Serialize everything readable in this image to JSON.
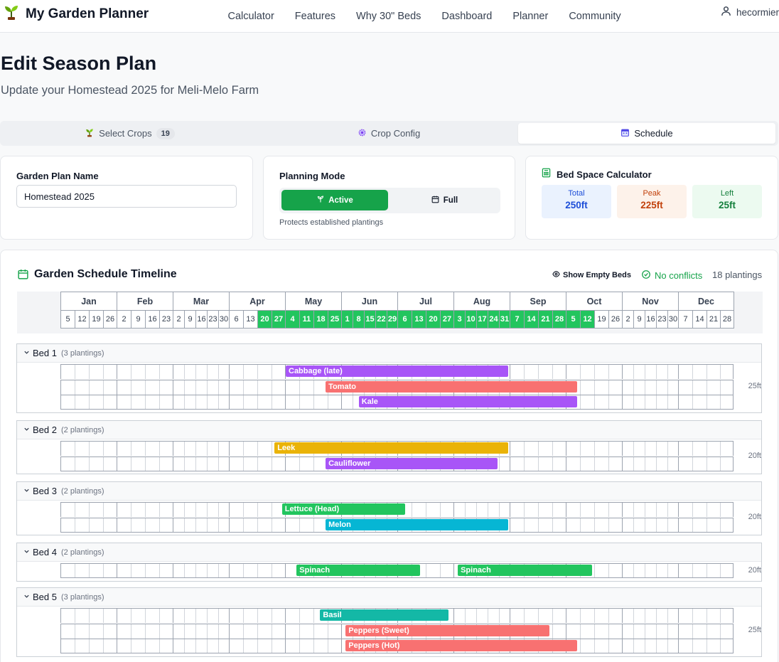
{
  "nav": {
    "brand": "My Garden Planner",
    "links": [
      "Calculator",
      "Features",
      "Why 30\" Beds",
      "Dashboard",
      "Planner",
      "Community"
    ],
    "user": "hecormier"
  },
  "page": {
    "title": "Edit Season Plan",
    "subtitle": "Update your Homestead 2025 for Meli-Melo Farm"
  },
  "tabs": [
    {
      "label": "Select Crops",
      "badge": "19",
      "icon": "seedling-icon"
    },
    {
      "label": "Crop Config",
      "icon": "gear-icon"
    },
    {
      "label": "Schedule",
      "icon": "calendar-icon",
      "active": true
    }
  ],
  "plan_name": {
    "label": "Garden Plan Name",
    "value": "Homestead 2025"
  },
  "planning_mode": {
    "label": "Planning Mode",
    "options": [
      {
        "label": "Active",
        "icon": "sprout-icon",
        "selected": true
      },
      {
        "label": "Full",
        "icon": "calendar-icon"
      }
    ],
    "help": "Protects established plantings"
  },
  "bed_space": {
    "title": "Bed Space Calculator",
    "total": {
      "label": "Total",
      "value": "250ft",
      "color": "#1d4ed8",
      "bg": "#eaf2fe"
    },
    "peak": {
      "label": "Peak",
      "value": "225ft",
      "color": "#c2410c",
      "bg": "#fdf2ea"
    },
    "left": {
      "label": "Left",
      "value": "25ft",
      "color": "#15803d",
      "bg": "#ecfaf0"
    }
  },
  "timeline": {
    "title": "Garden Schedule Timeline",
    "show_empty": "Show Empty Beds",
    "conflicts": "No conflicts",
    "plantings": "18 plantings",
    "months": [
      "Jan",
      "Feb",
      "Mar",
      "Apr",
      "May",
      "Jun",
      "Jul",
      "Aug",
      "Sep",
      "Oct",
      "Nov",
      "Dec"
    ],
    "weeks": [
      [
        "5",
        "12",
        "19",
        "26"
      ],
      [
        "2",
        "9",
        "16",
        "23"
      ],
      [
        "2",
        "9",
        "16",
        "23",
        "30"
      ],
      [
        "6",
        "13",
        "20",
        "27"
      ],
      [
        "4",
        "11",
        "18",
        "25"
      ],
      [
        "1",
        "8",
        "15",
        "22",
        "29"
      ],
      [
        "6",
        "13",
        "20",
        "27"
      ],
      [
        "3",
        "10",
        "17",
        "24",
        "31"
      ],
      [
        "7",
        "14",
        "21",
        "28"
      ],
      [
        "5",
        "12",
        "19",
        "26"
      ],
      [
        "2",
        "9",
        "16",
        "23",
        "30"
      ],
      [
        "7",
        "14",
        "21",
        "28"
      ]
    ],
    "highlight_start": "Apr 20",
    "highlight_end": "Oct 12"
  },
  "beds": [
    {
      "name": "Bed 1",
      "count": "(3 plantings)",
      "length": "25ft",
      "rows": [
        [
          {
            "crop": "Cabbage (late)",
            "color": "#a855f7",
            "start": "May 1",
            "end": "Aug 31"
          }
        ],
        [
          {
            "crop": "Tomato",
            "color": "#f87171",
            "start": "May 23",
            "end": "Oct 7"
          }
        ],
        [
          {
            "crop": "Kale",
            "color": "#a855f7",
            "start": "Jun 10",
            "end": "Oct 7"
          }
        ]
      ]
    },
    {
      "name": "Bed 2",
      "count": "(2 plantings)",
      "length": "20ft",
      "rows": [
        [
          {
            "crop": "Leek",
            "color": "#eab308",
            "start": "Apr 25",
            "end": "Aug 31"
          }
        ],
        [
          {
            "crop": "Cauliflower",
            "color": "#a855f7",
            "start": "May 23",
            "end": "Aug 25"
          }
        ]
      ]
    },
    {
      "name": "Bed 3",
      "count": "(2 plantings)",
      "length": "20ft",
      "rows": [
        [
          {
            "crop": "Lettuce (Head)",
            "color": "#22c55e",
            "start": "Apr 29",
            "end": "Jul 5"
          }
        ],
        [
          {
            "crop": "Melon",
            "color": "#06b6d4",
            "start": "May 23",
            "end": "Aug 31"
          }
        ]
      ]
    },
    {
      "name": "Bed 4",
      "count": "(2 plantings)",
      "length": "20ft",
      "rows": [
        [
          {
            "crop": "Spinach",
            "color": "#22c55e",
            "start": "May 7",
            "end": "Jul 13"
          },
          {
            "crop": "Spinach",
            "color": "#22c55e",
            "start": "Aug 3",
            "end": "Oct 15"
          }
        ]
      ]
    },
    {
      "name": "Bed 5",
      "count": "(3 plantings)",
      "length": "25ft",
      "rows": [
        [
          {
            "crop": "Basil",
            "color": "#14b8a6",
            "start": "May 20",
            "end": "Jul 29"
          }
        ],
        [
          {
            "crop": "Peppers (Sweet)",
            "color": "#f87171",
            "start": "Jun 3",
            "end": "Sep 22"
          }
        ],
        [
          {
            "crop": "Peppers (Hot)",
            "color": "#f87171",
            "start": "Jun 3",
            "end": "Oct 7"
          }
        ]
      ]
    }
  ]
}
